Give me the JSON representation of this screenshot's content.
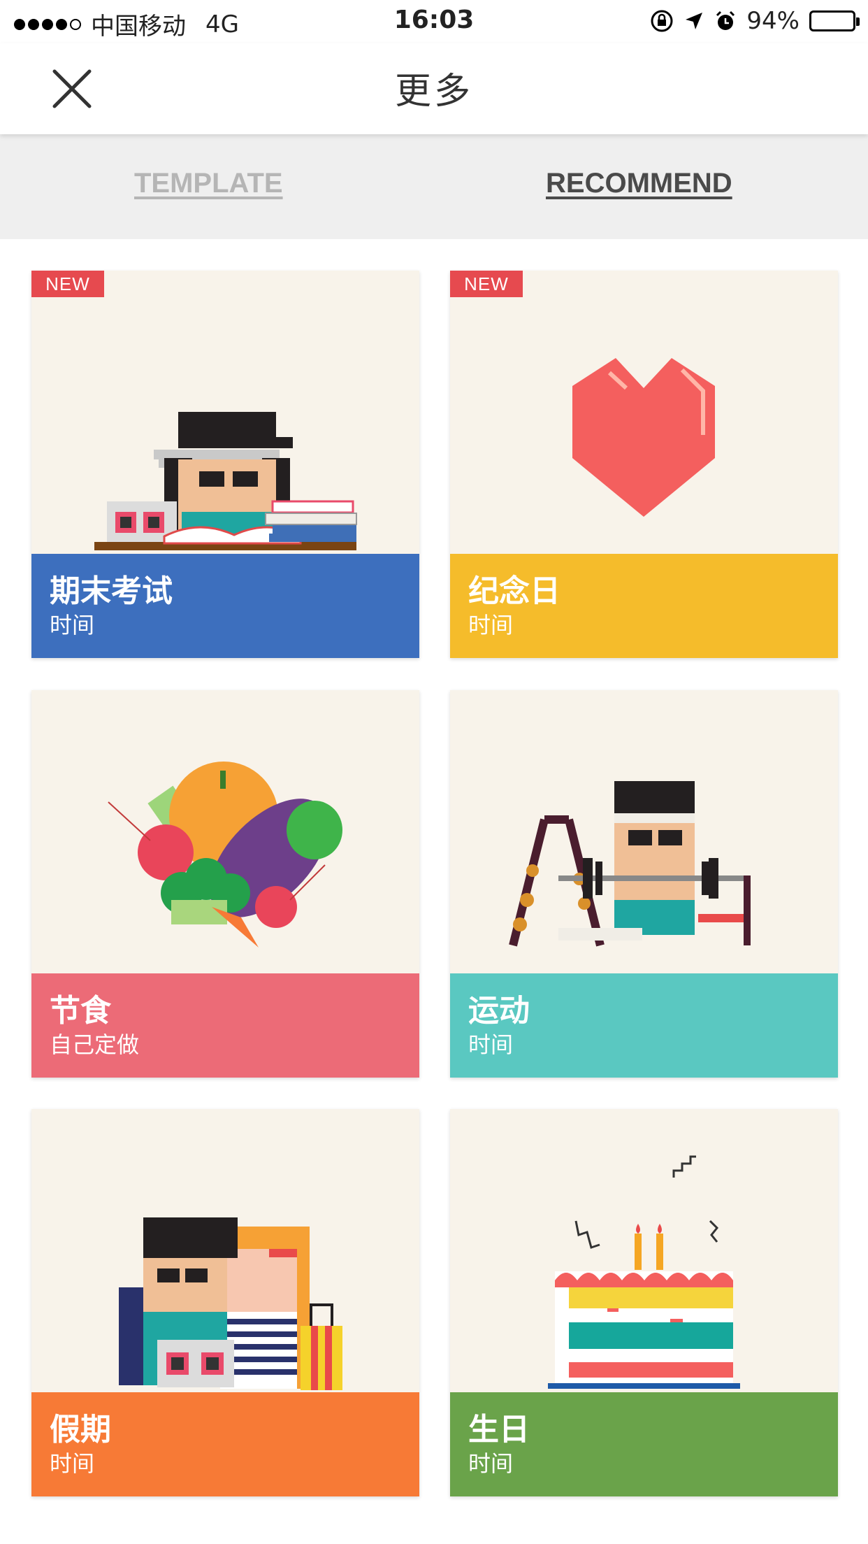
{
  "status_bar": {
    "carrier": "中国移动",
    "network": "4G",
    "time": "16:03",
    "battery": "94%",
    "battery_level": 0.94
  },
  "nav": {
    "title": "更多",
    "close_icon": "close-icon"
  },
  "tabs": [
    {
      "label": "TEMPLATE",
      "active": false
    },
    {
      "label": "RECOMMEND",
      "active": true
    }
  ],
  "badge_text": "NEW",
  "cards": [
    {
      "title": "期末考试",
      "subtitle": "时间",
      "color": "#3d6fbe",
      "is_new": true,
      "icon": "student-studying-illustration"
    },
    {
      "title": "纪念日",
      "subtitle": "时间",
      "color": "#f5bc2b",
      "is_new": true,
      "icon": "heart-illustration"
    },
    {
      "title": "节食",
      "subtitle": "自己定做",
      "color": "#ec6b77",
      "is_new": false,
      "icon": "vegetables-illustration"
    },
    {
      "title": "运动",
      "subtitle": "时间",
      "color": "#5ac8c1",
      "is_new": false,
      "icon": "weightlifting-illustration"
    },
    {
      "title": "假期",
      "subtitle": "时间",
      "color": "#f77a36",
      "is_new": false,
      "icon": "travel-illustration"
    },
    {
      "title": "生日",
      "subtitle": "时间",
      "color": "#6aa34a",
      "is_new": false,
      "icon": "birthday-cake-illustration"
    }
  ]
}
